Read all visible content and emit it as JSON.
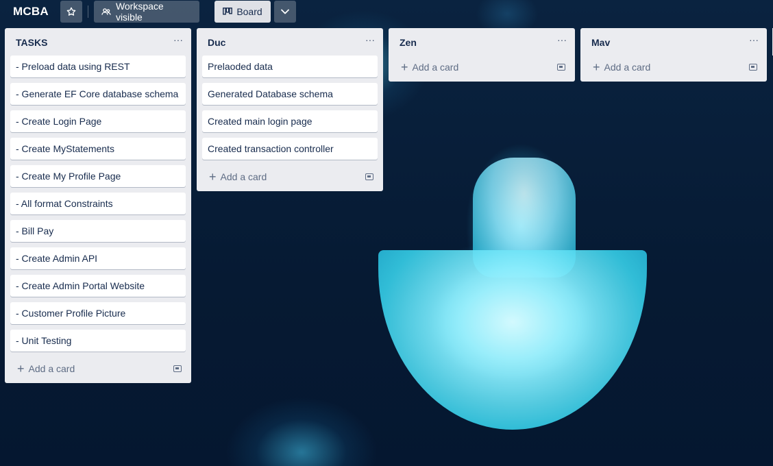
{
  "board": {
    "title": "MCBA",
    "workspace_label": "Workspace visible",
    "view_label": "Board"
  },
  "icons": {
    "star": "star-icon",
    "workspace": "people-icon",
    "board": "board-icon",
    "chevron": "chevron-down-icon",
    "menu": "ellipsis-icon",
    "add": "plus-icon",
    "template": "card-template-icon"
  },
  "colors": {
    "header_button_bg": "rgba(255,255,255,0.24)",
    "list_bg": "#ebecf0",
    "card_bg": "#ffffff",
    "text": "#172b4d",
    "muted": "#5e6c84"
  },
  "lists": [
    {
      "title": "TASKS",
      "menu_label": "···",
      "cards": [
        "- Preload data using REST",
        "- Generate EF Core database schema",
        "- Create Login Page",
        "- Create MyStatements",
        "- Create My Profile Page",
        "- All format Constraints",
        "- Bill Pay",
        "- Create Admin API",
        "- Create Admin Portal Website",
        "- Customer Profile Picture",
        "- Unit Testing"
      ],
      "add_card_label": "Add a card"
    },
    {
      "title": "Duc",
      "menu_label": "···",
      "cards": [
        "Prelaoded data",
        "Generated Database schema",
        "Created main login page",
        "Created transaction controller"
      ],
      "add_card_label": "Add a card"
    },
    {
      "title": "Zen",
      "menu_label": "···",
      "cards": [],
      "add_card_label": "Add a card"
    },
    {
      "title": "Mav",
      "menu_label": "···",
      "cards": [],
      "add_card_label": "Add a card"
    }
  ]
}
